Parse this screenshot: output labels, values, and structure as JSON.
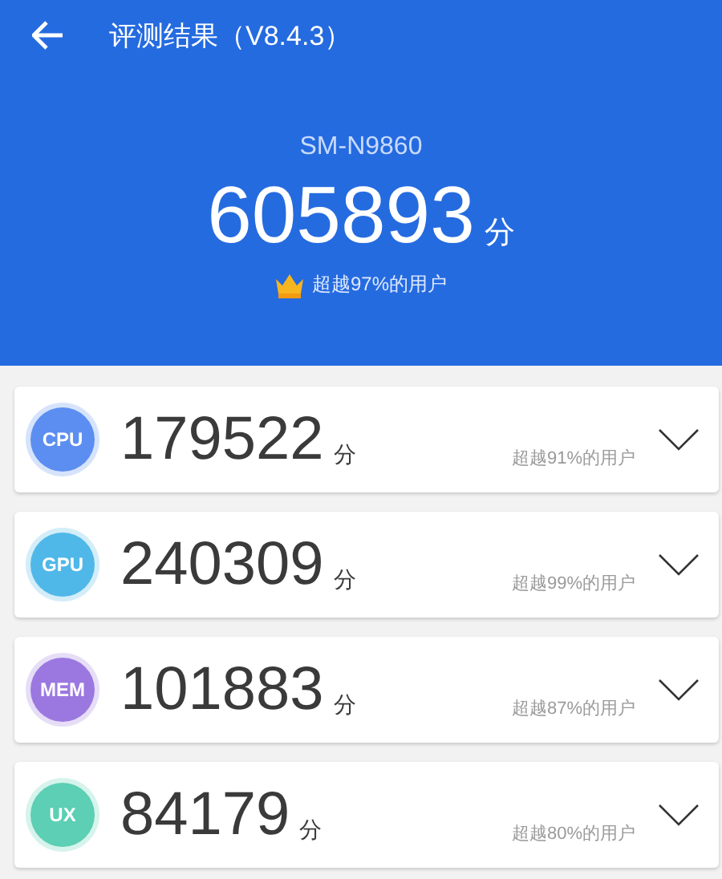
{
  "header": {
    "title": "评测结果（V8.4.3）",
    "device": "SM-N9860",
    "total_score": "605893",
    "score_unit": "分",
    "rank": "超越97%的用户"
  },
  "categories": [
    {
      "badge": "CPU",
      "color": "#5b8ef0",
      "score": "179522",
      "unit": "分",
      "rank": "超越91%的用户",
      "expanded": false
    },
    {
      "badge": "GPU",
      "color": "#4fb8e8",
      "score": "240309",
      "unit": "分",
      "rank": "超越99%的用户",
      "expanded": false
    },
    {
      "badge": "MEM",
      "color": "#9b78e0",
      "score": "101883",
      "unit": "分",
      "rank": "超越87%的用户",
      "expanded": false
    },
    {
      "badge": "UX",
      "color": "#5ccfb4",
      "score": "84179",
      "unit": "分",
      "rank": "超越80%的用户",
      "expanded": false
    }
  ]
}
